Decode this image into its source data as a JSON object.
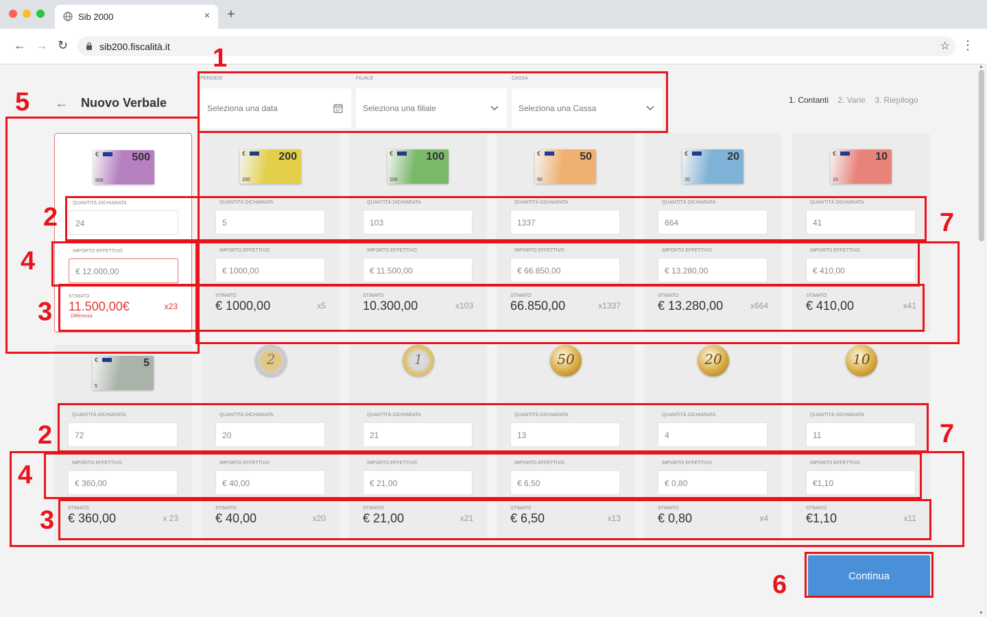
{
  "browser": {
    "tab_title": "Sib 2000",
    "new_tab": "+",
    "close": "×",
    "url": "sib200.fiscalità.it"
  },
  "header": {
    "back": "←",
    "title": "Nuovo Verbale",
    "steps": [
      "1. Contanti",
      "2. Varie",
      "3. Riepilogo"
    ]
  },
  "filters": {
    "periodo": {
      "label": "PERIODO",
      "placeholder": "Seleziona una data"
    },
    "filiale": {
      "label": "FILIALE",
      "placeholder": "Seleziona una filiale"
    },
    "cassa": {
      "label": "CASSA",
      "placeholder": "Seleziona una Cassa"
    }
  },
  "labels": {
    "quantita": "QUANTITÀ DICHIARATA",
    "importo": "IMPORTO EFFETTIVO",
    "stimato": "STIMATO",
    "differenza": "Differenza"
  },
  "denominations": [
    {
      "denom": "500",
      "type": "note",
      "color": "#b57fc0",
      "quantita": "24",
      "importo": "€ 12.000,00",
      "stimato": "11.500,00€",
      "mult": "x23",
      "error": true
    },
    {
      "denom": "200",
      "type": "note",
      "color": "#e3cf4a",
      "quantita": "5",
      "importo": "€ 1000,00",
      "stimato": "€ 1000,00",
      "mult": "x5"
    },
    {
      "denom": "100",
      "type": "note",
      "color": "#7ab86a",
      "quantita": "103",
      "importo": "€ 11.500,00",
      "stimato": "10.300,00",
      "mult": "x103"
    },
    {
      "denom": "50",
      "type": "note",
      "color": "#f0b070",
      "quantita": "1337",
      "importo": "€ 66.850,00",
      "stimato": "66.850,00",
      "mult": "x1337"
    },
    {
      "denom": "20",
      "type": "note",
      "color": "#7fb2d6",
      "quantita": "664",
      "importo": "€ 13.280,00",
      "stimato": "€ 13.280,00",
      "mult": "x664"
    },
    {
      "denom": "10",
      "type": "note",
      "color": "#e8837a",
      "quantita": "41",
      "importo": "€ 410,00",
      "stimato": "€ 410,00",
      "mult": "x41"
    },
    {
      "denom": "5",
      "type": "note",
      "color": "#a9b3aa",
      "quantita": "72",
      "importo": "€ 360,00",
      "stimato": "€ 360,00",
      "mult": "x 23"
    },
    {
      "denom": "2",
      "type": "coin",
      "color": "#d9d9d9",
      "quantita": "20",
      "importo": "€ 40,00",
      "stimato": "€ 40,00",
      "mult": "x20"
    },
    {
      "denom": "1",
      "type": "coin",
      "color": "#e6cf8a",
      "quantita": "21",
      "importo": "€ 21,00",
      "stimato": "€ 21,00",
      "mult": "x21"
    },
    {
      "denom": "50",
      "type": "coin",
      "color": "#d4a53a",
      "quantita": "13",
      "importo": "€ 6,50",
      "stimato": "€ 6,50",
      "mult": "x13"
    },
    {
      "denom": "20",
      "type": "coin",
      "color": "#d4a53a",
      "quantita": "4",
      "importo": "€ 0,80",
      "stimato": "€ 0,80",
      "mult": "x4"
    },
    {
      "denom": "10",
      "type": "coin",
      "color": "#d4a53a",
      "quantita": "11",
      "importo": "€1,10",
      "stimato": "€1,10",
      "mult": "x11"
    }
  ],
  "continue_label": "Continua",
  "annotations": [
    "1",
    "2",
    "3",
    "4",
    "5",
    "6",
    "7",
    "2",
    "3",
    "4",
    "7"
  ],
  "colors": {
    "accent": "#4a90d9",
    "error": "#e53935",
    "annotation": "#e8141c"
  }
}
